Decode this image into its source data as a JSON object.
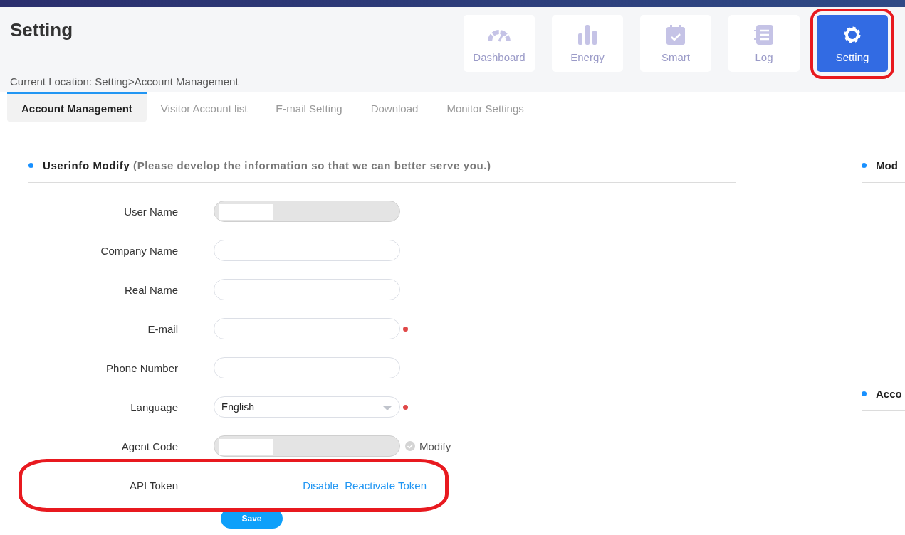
{
  "page": {
    "title": "Setting",
    "breadcrumb": "Current Location: Setting>Account Management"
  },
  "nav": [
    {
      "label": "Dashboard",
      "selected": false,
      "highlighted": false
    },
    {
      "label": "Energy",
      "selected": false,
      "highlighted": false
    },
    {
      "label": "Smart",
      "selected": false,
      "highlighted": false
    },
    {
      "label": "Log",
      "selected": false,
      "highlighted": false
    },
    {
      "label": "Setting",
      "selected": true,
      "highlighted": true
    }
  ],
  "tabs": [
    {
      "label": "Account Management",
      "selected": true
    },
    {
      "label": "Visitor Account list",
      "selected": false
    },
    {
      "label": "E-mail Setting",
      "selected": false
    },
    {
      "label": "Download",
      "selected": false
    },
    {
      "label": "Monitor Settings",
      "selected": false
    }
  ],
  "userinfo": {
    "title": "Userinfo Modify",
    "note": "(Please develop the information so that we can better serve you.)",
    "fields": [
      {
        "kind": "text",
        "label": "User Name",
        "disabled": true,
        "redacted": true,
        "required": false
      },
      {
        "kind": "text",
        "label": "Company Name",
        "disabled": false,
        "redacted": false,
        "required": false
      },
      {
        "kind": "text",
        "label": "Real Name",
        "disabled": false,
        "redacted": false,
        "required": false
      },
      {
        "kind": "text",
        "label": "E-mail",
        "disabled": false,
        "redacted": false,
        "required": true
      },
      {
        "kind": "text",
        "label": "Phone Number",
        "disabled": false,
        "redacted": false,
        "required": false
      },
      {
        "kind": "select",
        "label": "Language",
        "value": "English",
        "disabled": false,
        "redacted": false,
        "required": true
      },
      {
        "kind": "text",
        "label": "Agent Code",
        "disabled": true,
        "redacted": true,
        "required": false,
        "action": "Modify"
      },
      {
        "kind": "links",
        "label": "API Token",
        "links": [
          "Disable",
          "Reactivate Token"
        ],
        "highlighted": true
      }
    ],
    "save": "Save"
  },
  "side_sections": [
    {
      "title": "Mod"
    },
    {
      "title": "Acco"
    }
  ]
}
